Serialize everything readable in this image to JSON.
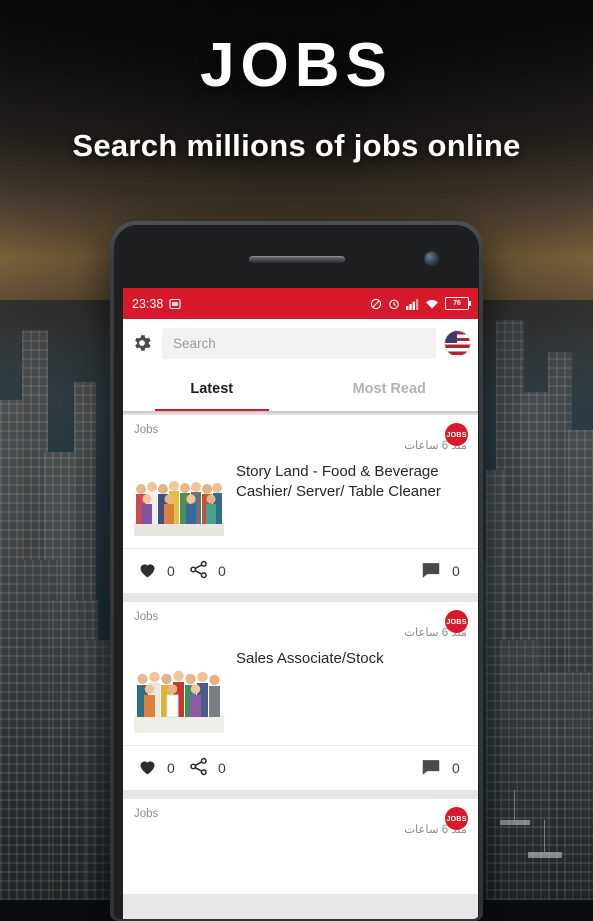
{
  "promo": {
    "title": "JOBS",
    "subtitle": "Search millions of jobs online"
  },
  "colors": {
    "brand_red": "#d6192b",
    "status_bar": "#d6192b",
    "tab_active_text": "#1d1d1d",
    "tab_inactive_text": "#b3b3b3",
    "feed_background": "#e6e6e6"
  },
  "phone": {
    "status_bar": {
      "time": "23:38",
      "icons": [
        "sim-card-icon",
        "alarm-icon",
        "clock-icon",
        "signal-icon",
        "wifi-icon",
        "battery-icon"
      ],
      "battery_level": "76"
    },
    "toolbar": {
      "settings_icon": "gear-icon",
      "search_placeholder": "Search",
      "search_value": "",
      "language_flag": "us-flag-icon"
    },
    "tabs": [
      {
        "label": "Latest",
        "active": true
      },
      {
        "label": "Most Read",
        "active": false
      }
    ],
    "feed": [
      {
        "category": "Jobs",
        "time": "منذ 6 ساعات",
        "badge": "JOBS",
        "title": "Story Land - Food & Beverage Cashier/ Server/ Table Cleaner",
        "thumbnail": "group-of-workers-photo",
        "likes": "0",
        "shares": "0",
        "comments": "0"
      },
      {
        "category": "Jobs",
        "time": "منذ 6 ساعات",
        "badge": "JOBS",
        "title": "Sales Associate/Stock",
        "thumbnail": "group-of-people-photo",
        "likes": "0",
        "shares": "0",
        "comments": "0"
      },
      {
        "category": "Jobs",
        "time": "منذ 6 ساعات",
        "badge": "JOBS",
        "title": "",
        "thumbnail": "",
        "likes": "",
        "shares": "",
        "comments": ""
      }
    ]
  }
}
